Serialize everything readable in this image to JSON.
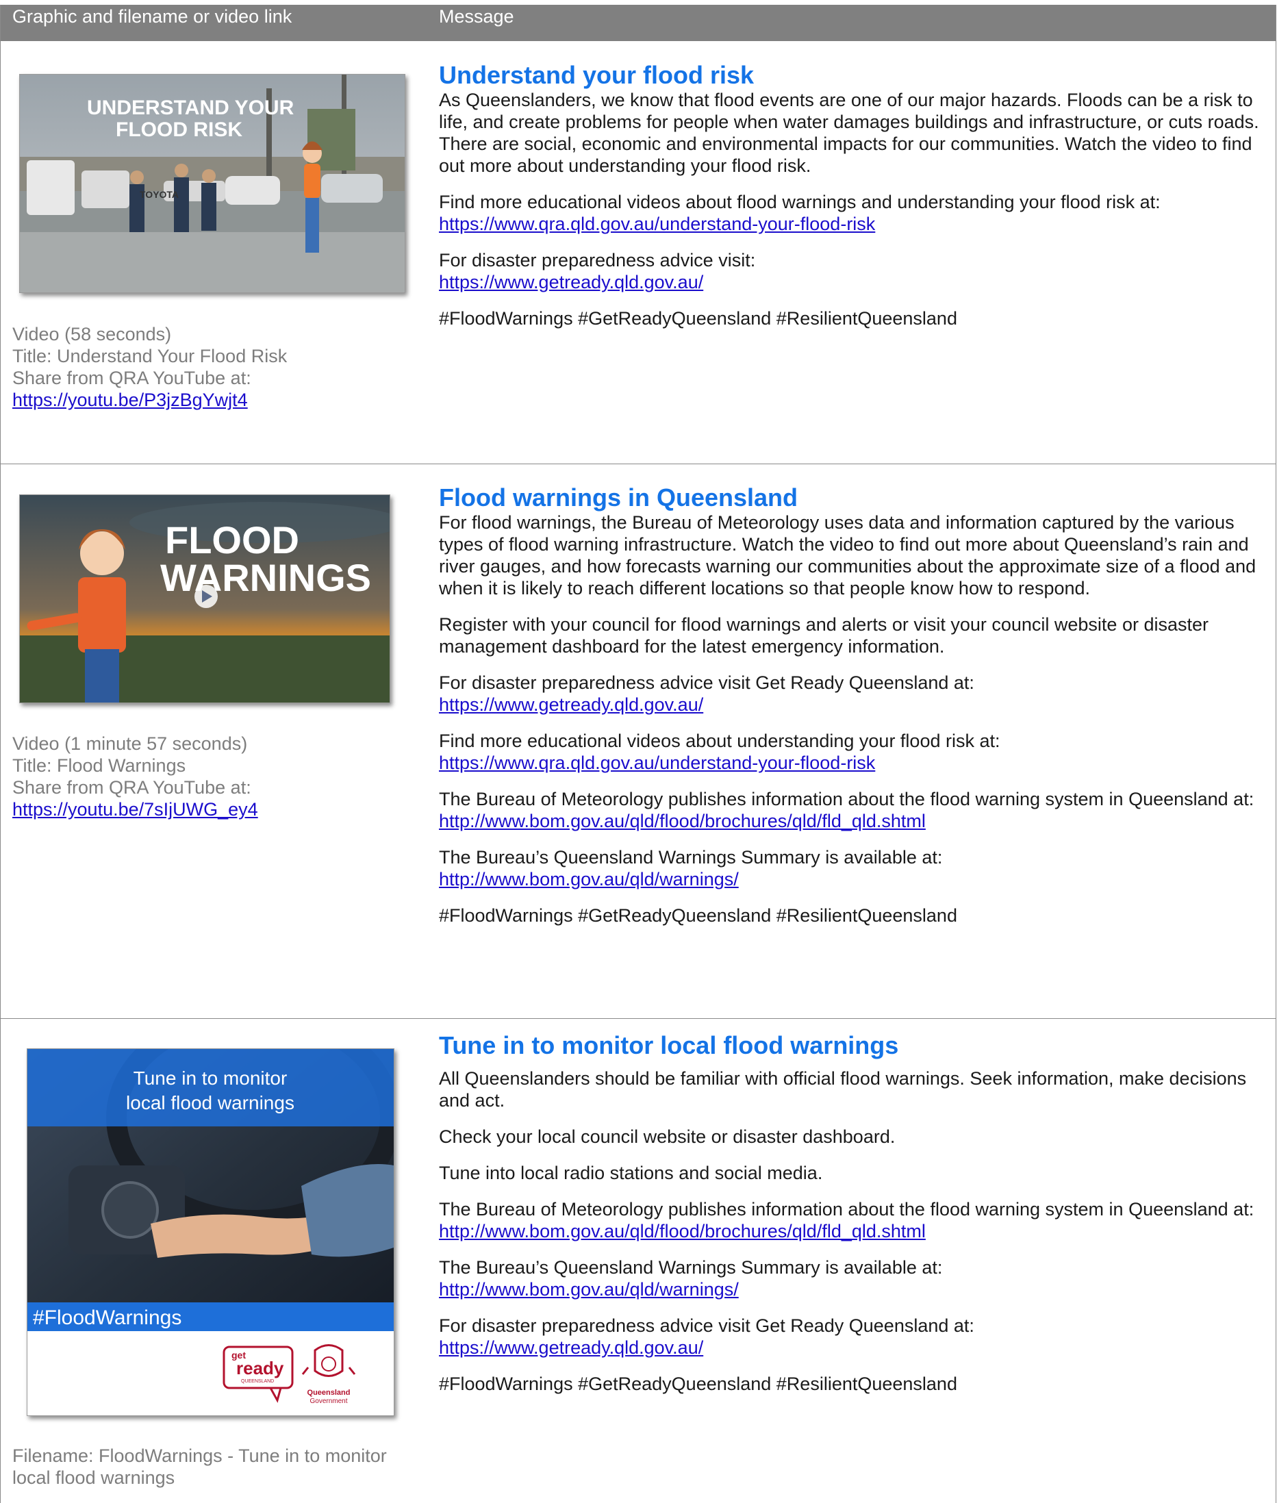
{
  "header": {
    "col1": "Graphic and filename or video link",
    "col2": "Message"
  },
  "rows": [
    {
      "thumb_text": "UNDERSTAND YOUR FLOOD RISK",
      "thumb_badge": "TOYOTA",
      "caption_lines": [
        "Video (58 seconds)",
        "Title: Understand Your Flood Risk",
        "Share from QRA YouTube at:"
      ],
      "caption_link": "https://youtu.be/P3jzBgYwjt4",
      "title": "Understand your flood risk",
      "paragraphs": [
        {
          "text": "As Queenslanders, we know that flood events are one of our major hazards. Floods can be a risk to life, and create problems for people when water damages buildings and infrastructure, or cuts roads. There are social, economic and environmental impacts for our communities. Watch the video to find out more about understanding your flood risk."
        },
        {
          "text": "Find more educational videos about flood warnings and understanding your flood risk at:",
          "link": "https://www.qra.qld.gov.au/understand-your-flood-risk"
        },
        {
          "text": "For disaster preparedness advice visit:",
          "link": "https://www.getready.qld.gov.au/"
        },
        {
          "text": "#FloodWarnings #GetReadyQueensland #ResilientQueensland"
        }
      ]
    },
    {
      "thumb_text_1": "FLOOD",
      "thumb_text_2": "WARNINGS",
      "caption_lines": [
        "Video (1 minute 57 seconds)",
        "Title: Flood Warnings",
        "Share from QRA YouTube at:"
      ],
      "caption_link": "https://youtu.be/7sIjUWG_ey4",
      "title": "Flood warnings in Queensland",
      "paragraphs": [
        {
          "text": "For flood warnings, the Bureau of Meteorology uses data and information captured by the various types of flood warning infrastructure. Watch the video to find out more about Queensland’s rain and river gauges, and how forecasts warning our communities about the approximate size of a flood and when it is likely to reach different locations so that people know how to respond."
        },
        {
          "text": "Register with your council for flood warnings and alerts or visit your council website or disaster management dashboard for the latest emergency information."
        },
        {
          "text": "For disaster preparedness advice visit Get Ready Queensland at:",
          "link": "https://www.getready.qld.gov.au/"
        },
        {
          "text": "Find more educational videos about understanding your flood risk at:",
          "link": "https://www.qra.qld.gov.au/understand-your-flood-risk"
        },
        {
          "text": "The Bureau of Meteorology publishes information about the flood warning system in Queensland at:",
          "link": "http://www.bom.gov.au/qld/flood/brochures/qld/fld_qld.shtml"
        },
        {
          "text": "The Bureau’s Queensland Warnings Summary is available at:",
          "link": "http://www.bom.gov.au/qld/warnings/"
        },
        {
          "text": "#FloodWarnings #GetReadyQueensland #ResilientQueensland"
        }
      ]
    },
    {
      "thumb_banner_1": "Tune in to monitor",
      "thumb_banner_2": "local flood warnings",
      "thumb_hashtag": "#FloodWarnings",
      "logo_get": "get",
      "logo_ready": "ready",
      "logo_qld": "QUEENSLAND",
      "gov_1": "Queensland",
      "gov_2": "Government",
      "caption_lines": [
        "Filename: FloodWarnings - Tune in to monitor",
        "local flood warnings"
      ],
      "title": "Tune in to monitor local flood warnings",
      "paragraphs": [
        {
          "text": "All Queenslanders should be familiar with official flood warnings. Seek information, make decisions and act."
        },
        {
          "text": "Check your local council website or disaster dashboard."
        },
        {
          "text": "Tune into local radio stations and social media."
        },
        {
          "text": "The Bureau of Meteorology publishes information about the flood warning system in Queensland at:",
          "link": "http://www.bom.gov.au/qld/flood/brochures/qld/fld_qld.shtml"
        },
        {
          "text": "The Bureau’s Queensland Warnings Summary is available at:",
          "link": "http://www.bom.gov.au/qld/warnings/"
        },
        {
          "text": "For disaster preparedness advice visit Get Ready Queensland at:",
          "link": "https://www.getready.qld.gov.au/"
        },
        {
          "text": "#FloodWarnings #GetReadyQueensland #ResilientQueensland"
        }
      ]
    }
  ],
  "colors": {
    "header_bg": "#808080",
    "title": "#1473e6",
    "link": "#1a0dcc",
    "caption": "#7d7d7d",
    "banner_blue": "#1e6fd9"
  }
}
